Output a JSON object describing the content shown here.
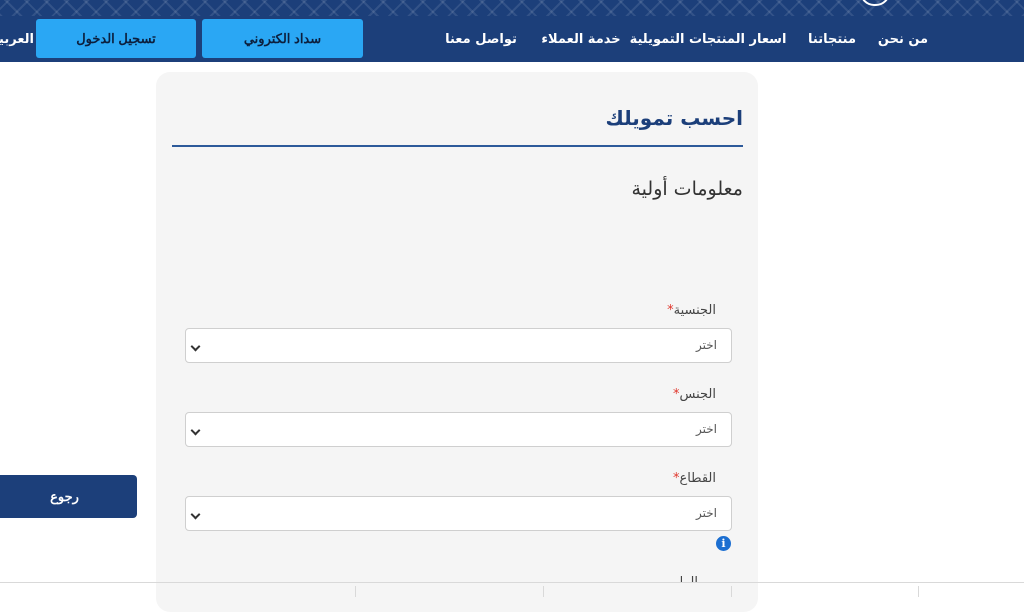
{
  "header": {
    "colors": {
      "background": "#1c3f7a",
      "button": "#2aa7f4"
    },
    "nav": {
      "about": "من نحن",
      "products": "منتجاتنا",
      "prices": "اسعار المنتجات التمويلية",
      "service": "خدمة العملاء",
      "contact": "تواصل معنا"
    },
    "pay_button": "سداد الكتروني",
    "login_button": "تسجيل الدخول",
    "language": "العربية"
  },
  "calculator": {
    "title": "احسب تمويلك",
    "section_title": "معلومات أولية",
    "fields": [
      {
        "label": "الجنسية",
        "required": "*",
        "value": "اختر"
      },
      {
        "label": "الجنس",
        "required": "*",
        "value": "اختر"
      },
      {
        "label": "القطاع",
        "required": "*",
        "value": "اختر"
      }
    ],
    "next_label_partial": "الرا"
  },
  "back_button": "رجوع",
  "icons": [
    "info-icon",
    "chevron-down-icon"
  ]
}
